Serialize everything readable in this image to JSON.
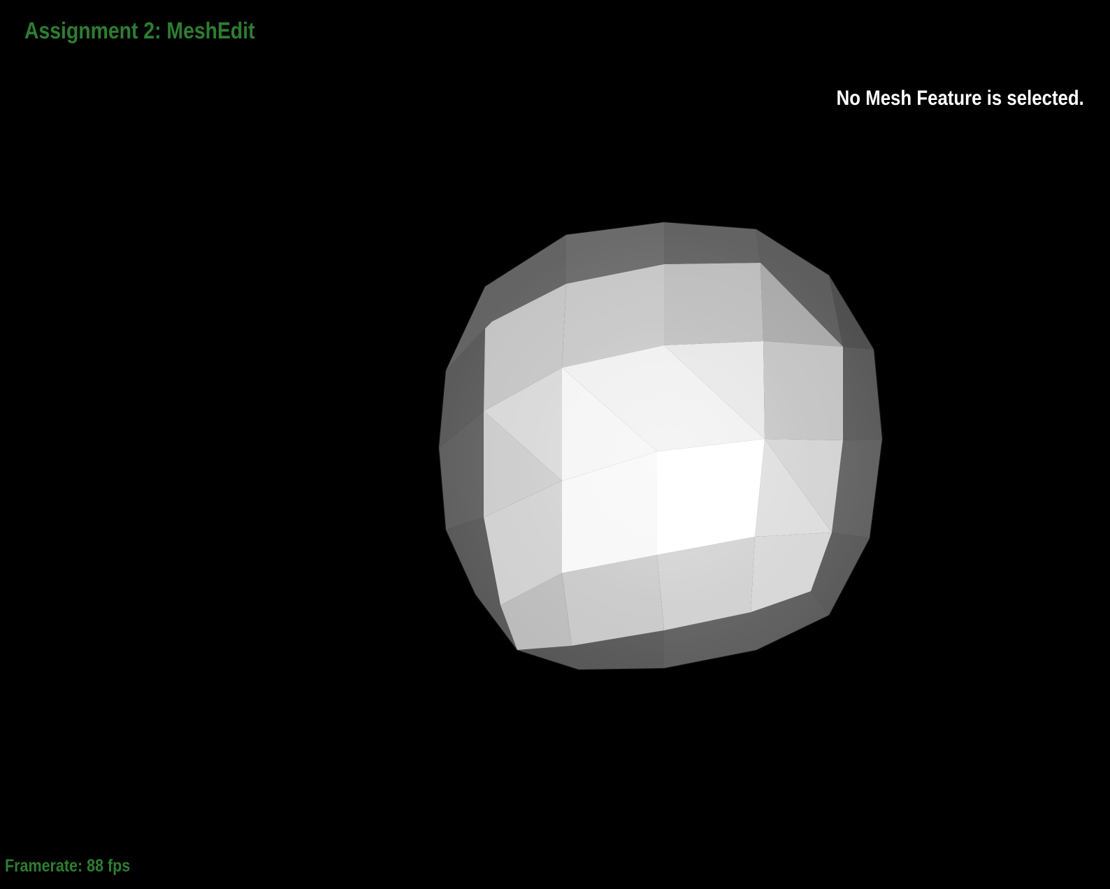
{
  "app": {
    "title": "Assignment 2: MeshEdit",
    "title_color": "#2e7d32"
  },
  "selection": {
    "status_text": "No Mesh Feature is selected.",
    "text_color": "#ffffff"
  },
  "stats": {
    "framerate_text": "Framerate: 88 fps",
    "color": "#2e7d32"
  },
  "viewport": {
    "background": "#000000",
    "mesh_shape": "faceted sphere"
  }
}
